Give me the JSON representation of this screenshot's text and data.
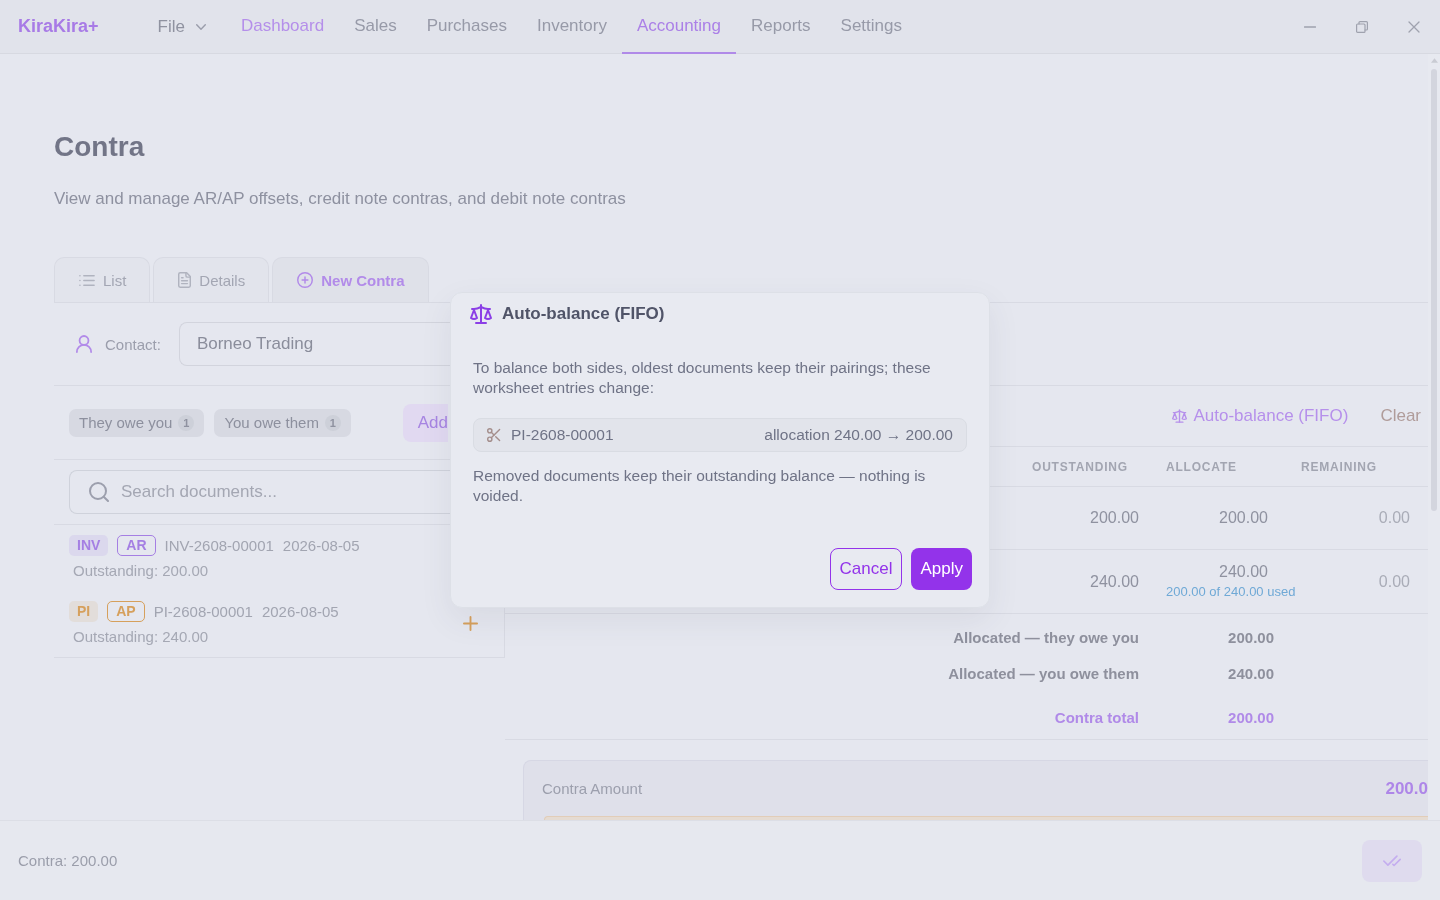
{
  "app": {
    "logo": "KiraKira+"
  },
  "menu": {
    "label": "File"
  },
  "nav": [
    {
      "label": "Dashboard",
      "selected": false,
      "highlighted": true
    },
    {
      "label": "Sales",
      "selected": false,
      "highlighted": false
    },
    {
      "label": "Purchases",
      "selected": false,
      "highlighted": false
    },
    {
      "label": "Inventory",
      "selected": false,
      "highlighted": false
    },
    {
      "label": "Accounting",
      "selected": true,
      "highlighted": false
    },
    {
      "label": "Reports",
      "selected": false,
      "highlighted": false
    },
    {
      "label": "Settings",
      "selected": false,
      "highlighted": false
    }
  ],
  "page": {
    "title": "Contra",
    "subtitle": "View and manage AR/AP offsets, credit note contras, and debit note contras"
  },
  "tabs": [
    {
      "kind": "list",
      "label": "List",
      "selected": false
    },
    {
      "kind": "details",
      "label": "Details",
      "selected": false
    },
    {
      "kind": "new",
      "label": "New Contra",
      "selected": true
    }
  ],
  "contact": {
    "label": "Contact:",
    "value": "Borneo Trading"
  },
  "documents": {
    "filters": [
      {
        "label": "They owe you",
        "count": "1"
      },
      {
        "label": "You owe them",
        "count": "1"
      }
    ],
    "add_button": {
      "label": "Add",
      "disabled": true
    },
    "search": {
      "placeholder": "Search documents..."
    },
    "items": [
      {
        "type": "INV",
        "side": "AR",
        "color": "#a57fe3",
        "number": "INV-2608-00001",
        "date": "2026-08-05",
        "outstanding": "Outstanding: 200.00"
      },
      {
        "type": "PI",
        "side": "AP",
        "color": "#d6a05c",
        "number": "PI-2608-00001",
        "date": "2026-08-05",
        "outstanding": "Outstanding: 240.00",
        "add_button": true
      }
    ]
  },
  "worksheet": {
    "actions": [
      {
        "kind": "auto_balance",
        "label": "Auto-balance (FIFO)"
      },
      {
        "kind": "clear",
        "label": "Clear"
      }
    ],
    "columns": [
      "OUTSTANDING",
      "ALLOCATE",
      "REMAINING"
    ],
    "rows": [
      {
        "outstanding": "200.00",
        "allocate": "200.00",
        "remaining": "0.00"
      },
      {
        "outstanding": "240.00",
        "allocate": "240.00",
        "usage": "200.00 of 240.00 used",
        "remaining": "0.00"
      }
    ],
    "totals": [
      {
        "kind": "subtotal",
        "label": "Allocated — they owe you",
        "value": "200.00"
      },
      {
        "kind": "subtotal",
        "label": "Allocated — you owe them",
        "value": "240.00"
      },
      {
        "kind": "total",
        "label": "Contra total",
        "value": "200.00"
      }
    ]
  },
  "contra_amount": {
    "label": "Contra Amount",
    "value": "200.0"
  },
  "footer": {
    "summary": "Contra: 200.00",
    "confirm_button": {
      "disabled": true
    }
  },
  "dialog": {
    "title": "Auto-balance (FIFO)",
    "message": "To balance both sides, oldest documents keep their pairings; these worksheet entries change:",
    "changes": [
      {
        "document": "PI-2608-00001",
        "change": "allocation 240.00 → 200.00"
      }
    ],
    "note": "Removed documents keep their outstanding balance — nothing is voided.",
    "buttons": [
      {
        "kind": "secondary",
        "label": "Cancel"
      },
      {
        "kind": "primary",
        "label": "Apply"
      }
    ]
  }
}
